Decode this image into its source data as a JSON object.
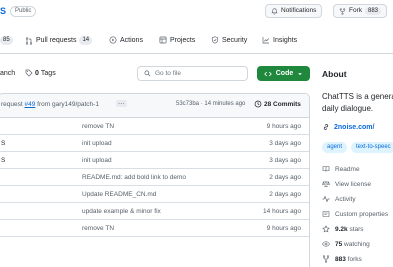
{
  "header": {
    "repo_fragment": "S",
    "visibility": "Public",
    "notifications_label": "Notifications",
    "fork_label": "Fork",
    "fork_count": "883"
  },
  "tabs": [
    {
      "label": "",
      "count": "85",
      "icon": "code-icon"
    },
    {
      "label": "Pull requests",
      "count": "14",
      "icon": "pull-request-icon"
    },
    {
      "label": "Actions",
      "count": "",
      "icon": "play-icon"
    },
    {
      "label": "Projects",
      "count": "",
      "icon": "table-icon"
    },
    {
      "label": "Security",
      "count": "",
      "icon": "shield-icon"
    },
    {
      "label": "Insights",
      "count": "",
      "icon": "graph-icon"
    }
  ],
  "branch_bar": {
    "branch_fragment": "anch",
    "tags_count": "0",
    "tags_label": "Tags",
    "search_placeholder": "Go to file",
    "code_label": "Code"
  },
  "latest_commit": {
    "prefix": "request",
    "pr_number": "#49",
    "suffix": "from gary149/patch-1",
    "ellipsis": "···",
    "hash_time": "53c73ba · 14 minutes ago",
    "commits_label": "28 Commits"
  },
  "files": [
    {
      "name": "",
      "message": "remove TN",
      "time": "9 hours ago"
    },
    {
      "name": "S",
      "message": "init upload",
      "time": "3 days ago"
    },
    {
      "name": "S",
      "message": "init upload",
      "time": "3 days ago"
    },
    {
      "name": "",
      "message": "README.md: add bold link to demo",
      "time": "2 days ago"
    },
    {
      "name": "",
      "message": "Update README_CN.md",
      "time": "2 days ago"
    },
    {
      "name": "",
      "message": "update example & minor fix",
      "time": "14 hours ago"
    },
    {
      "name": "",
      "message": "remove TN",
      "time": "9 hours ago"
    }
  ],
  "about": {
    "title": "About",
    "description_line1": "ChatTTS is a genera",
    "description_line2": "daily dialogue.",
    "website": "2noise.com/",
    "topics": [
      "agent",
      "text-to-speec"
    ],
    "items": [
      {
        "icon": "book-icon",
        "label": "Readme",
        "value": ""
      },
      {
        "icon": "law-icon",
        "label": "View license",
        "value": ""
      },
      {
        "icon": "pulse-icon",
        "label": "Activity",
        "value": ""
      },
      {
        "icon": "note-icon",
        "label": "Custom properties",
        "value": ""
      },
      {
        "icon": "star-icon",
        "label": "stars",
        "value": "9.2k"
      },
      {
        "icon": "eye-icon",
        "label": "watching",
        "value": "75"
      },
      {
        "icon": "fork-icon",
        "label": "forks",
        "value": "883"
      }
    ]
  },
  "colors": {
    "accent": "#0969da",
    "code_button": "#1f883d",
    "border": "#d0d7de",
    "muted_text": "#57606a"
  }
}
